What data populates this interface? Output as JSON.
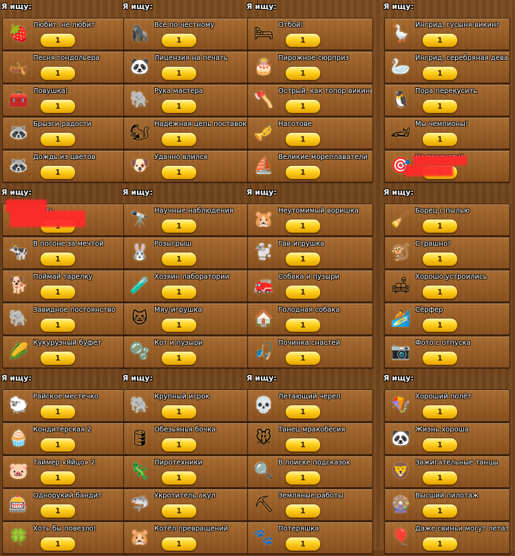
{
  "sections": [
    {
      "title": "Я ищу:",
      "quests": [
        {
          "title": "Любит, не любит",
          "count": "1",
          "icon": "🍓",
          "icon_name": "strawberry-icon"
        },
        {
          "title": "Песня гондольера",
          "count": "1",
          "icon": "🛶",
          "icon_name": "gondola-icon"
        },
        {
          "title": "Ловушка!",
          "count": "1",
          "icon": "🧰",
          "icon_name": "chest-icon"
        },
        {
          "title": "Брызги радости",
          "count": "1",
          "icon": "🦝",
          "icon_name": "raccoon-icon"
        },
        {
          "title": "Дождь из цветов",
          "count": "1",
          "icon": "🦝",
          "icon_name": "raccoon-icon"
        }
      ]
    },
    {
      "title": "Я ищу:",
      "quests": [
        {
          "title": "Всё по-честному",
          "count": "1",
          "icon": "🦍",
          "icon_name": "gorilla-icon"
        },
        {
          "title": "Лицензия на печать",
          "count": "1",
          "icon": "🐼",
          "icon_name": "panda-icon"
        },
        {
          "title": "Рука мастера",
          "count": "1",
          "icon": "🐘",
          "icon_name": "elephant-icon"
        },
        {
          "title": "Надёжная цепь поставок",
          "count": "1",
          "icon": "🐿",
          "icon_name": "squirrel-icon"
        },
        {
          "title": "Удачно влился",
          "count": "1",
          "icon": "🐶",
          "icon_name": "dog-icon"
        }
      ]
    },
    {
      "title": "Я ищу:",
      "quests": [
        {
          "title": "Отбой!",
          "count": "1",
          "icon": "🛏",
          "icon_name": "bed-icon"
        },
        {
          "title": "Пирожное-сюрприз",
          "count": "1",
          "icon": "🎂",
          "icon_name": "cake-icon"
        },
        {
          "title": "Острый, как топор викинга",
          "count": "1",
          "icon": "🪓",
          "icon_name": "axe-icon"
        },
        {
          "title": "Наготове",
          "count": "1",
          "icon": "🎺",
          "icon_name": "horn-icon"
        },
        {
          "title": "Великие мореплаватели",
          "count": "1",
          "icon": "⛵",
          "icon_name": "ship-icon"
        }
      ]
    },
    {
      "title": "Я ищу:",
      "quests": [
        {
          "title": "Ингрид, гусыня-викинг",
          "count": "1",
          "icon": "🪿",
          "icon_name": "goose-icon"
        },
        {
          "title": "Ингрид, серебряная дева",
          "count": "1",
          "icon": "🦢",
          "icon_name": "silver-goose-icon"
        },
        {
          "title": "Пора перекусить",
          "count": "1",
          "icon": "🐧",
          "icon_name": "penguin-icon"
        },
        {
          "title": "Мы чемпионы!",
          "count": "1",
          "icon": "🏎",
          "icon_name": "race-car-icon"
        },
        {
          "title": "Не пропусти!",
          "count": "1",
          "icon": "🎯",
          "icon_name": "target-icon"
        }
      ]
    },
    {
      "title": "Я ищу:",
      "quests": [
        {
          "title": "Честь",
          "count": "1",
          "icon": "",
          "icon_name": "hidden-icon"
        },
        {
          "title": "В погоне за мечтой",
          "count": "1",
          "icon": "🐄",
          "icon_name": "cow-icon"
        },
        {
          "title": "Поймай тарелку",
          "count": "1",
          "icon": "🐕",
          "icon_name": "dog-icon"
        },
        {
          "title": "Завидное постоянство",
          "count": "1",
          "icon": "🐘",
          "icon_name": "elephant-icon"
        },
        {
          "title": "Кукурузный буфет",
          "count": "1",
          "icon": "🌽",
          "icon_name": "corn-icon"
        }
      ]
    },
    {
      "title": "Я ищу:",
      "quests": [
        {
          "title": "Научные наблюдения",
          "count": "1",
          "icon": "🔭",
          "icon_name": "telescope-icon"
        },
        {
          "title": "Розыгрыш",
          "count": "1",
          "icon": "🐰",
          "icon_name": "bunny-icon"
        },
        {
          "title": "Хозяин лаборатории",
          "count": "1",
          "icon": "🧪",
          "icon_name": "flask-icon"
        },
        {
          "title": "Мяу-игрушка",
          "count": "1",
          "icon": "🐱",
          "icon_name": "cat-toy-icon"
        },
        {
          "title": "Кот и пузыри",
          "count": "1",
          "icon": "🫧",
          "icon_name": "bubbles-icon"
        }
      ]
    },
    {
      "title": "Я ищу:",
      "quests": [
        {
          "title": "Неутомимый воришка",
          "count": "1",
          "icon": "🐹",
          "icon_name": "hamster-wheel-icon"
        },
        {
          "title": "Гав-игрушка",
          "count": "1",
          "icon": "🐩",
          "icon_name": "poodle-icon"
        },
        {
          "title": "Собака и пузыри",
          "count": "1",
          "icon": "🚒",
          "icon_name": "hydrant-icon"
        },
        {
          "title": "Голодная собака",
          "count": "1",
          "icon": "🏠",
          "icon_name": "doghouse-icon"
        },
        {
          "title": "Починка снастей",
          "count": "1",
          "icon": "🎣",
          "icon_name": "fishing-icon"
        }
      ]
    },
    {
      "title": "Я ищу:",
      "quests": [
        {
          "title": "Борец с пылью",
          "count": "1",
          "icon": "🧹",
          "icon_name": "broom-icon"
        },
        {
          "title": "Страшно!",
          "count": "1",
          "icon": "🐒",
          "icon_name": "monkey-icon"
        },
        {
          "title": "Хорошо устроились",
          "count": "1",
          "icon": "🛋",
          "icon_name": "couch-icon"
        },
        {
          "title": "Сёрфер",
          "count": "1",
          "icon": "🏄",
          "icon_name": "surfer-icon"
        },
        {
          "title": "Фото с отпуска",
          "count": "1",
          "icon": "📷",
          "icon_name": "camera-icon"
        }
      ]
    },
    {
      "title": "Я ищу:",
      "quests": [
        {
          "title": "Райское местечко",
          "count": "1",
          "icon": "🐑",
          "icon_name": "sheep-icon"
        },
        {
          "title": "Кондитерская 2",
          "count": "1",
          "icon": "🧁",
          "icon_name": "bakery-icon"
        },
        {
          "title": "Таймер «Яйцо» 2",
          "count": "1",
          "icon": "🐷",
          "icon_name": "pig-icon"
        },
        {
          "title": "Однорукий бандит",
          "count": "1",
          "icon": "🎰",
          "icon_name": "slot-machine-icon"
        },
        {
          "title": "Хоть бы повезло!",
          "count": "1",
          "icon": "🍀",
          "icon_name": "clover-icon"
        }
      ]
    },
    {
      "title": "Я ищу:",
      "quests": [
        {
          "title": "Крупный игрок",
          "count": "1",
          "icon": "🐘",
          "icon_name": "elephant-icon"
        },
        {
          "title": "Обезьянья бочка",
          "count": "1",
          "icon": "🛢",
          "icon_name": "barrel-icon"
        },
        {
          "title": "Пиротехники",
          "count": "1",
          "icon": "🦎",
          "icon_name": "lizard-icon"
        },
        {
          "title": "Укротитель акул",
          "count": "1",
          "icon": "🦈",
          "icon_name": "shark-icon"
        },
        {
          "title": "Котёл превращений",
          "count": "1",
          "icon": "🐹",
          "icon_name": "hamster-icon"
        }
      ]
    },
    {
      "title": "Я ищу:",
      "quests": [
        {
          "title": "Летающий череп",
          "count": "1",
          "icon": "💀",
          "icon_name": "skull-icon"
        },
        {
          "title": "Танец мракобесия",
          "count": "1",
          "icon": "🐭",
          "icon_name": "mouse-icon"
        },
        {
          "title": "В поиске подсказок",
          "count": "1",
          "icon": "🔍",
          "icon_name": "magnifier-icon"
        },
        {
          "title": "Земляные работы",
          "count": "1",
          "icon": "⛏",
          "icon_name": "pickaxe-icon"
        },
        {
          "title": "Потеряшка",
          "count": "1",
          "icon": "🐾",
          "icon_name": "paws-icon"
        }
      ]
    },
    {
      "title": "Я ищу:",
      "quests": [
        {
          "title": "Хороший полёт",
          "count": "1",
          "icon": "🪁",
          "icon_name": "kite-icon"
        },
        {
          "title": "Жизнь хороша",
          "count": "1",
          "icon": "🐼",
          "icon_name": "panda-icon"
        },
        {
          "title": "Зажигательные танцы",
          "count": "1",
          "icon": "🦁",
          "icon_name": "lion-icon"
        },
        {
          "title": "Высший пилотаж",
          "count": "1",
          "icon": "🎡",
          "icon_name": "wheel-icon"
        },
        {
          "title": "Даже свиньи могут летать",
          "count": "1",
          "icon": "🎈",
          "icon_name": "balloons-icon"
        }
      ]
    }
  ]
}
